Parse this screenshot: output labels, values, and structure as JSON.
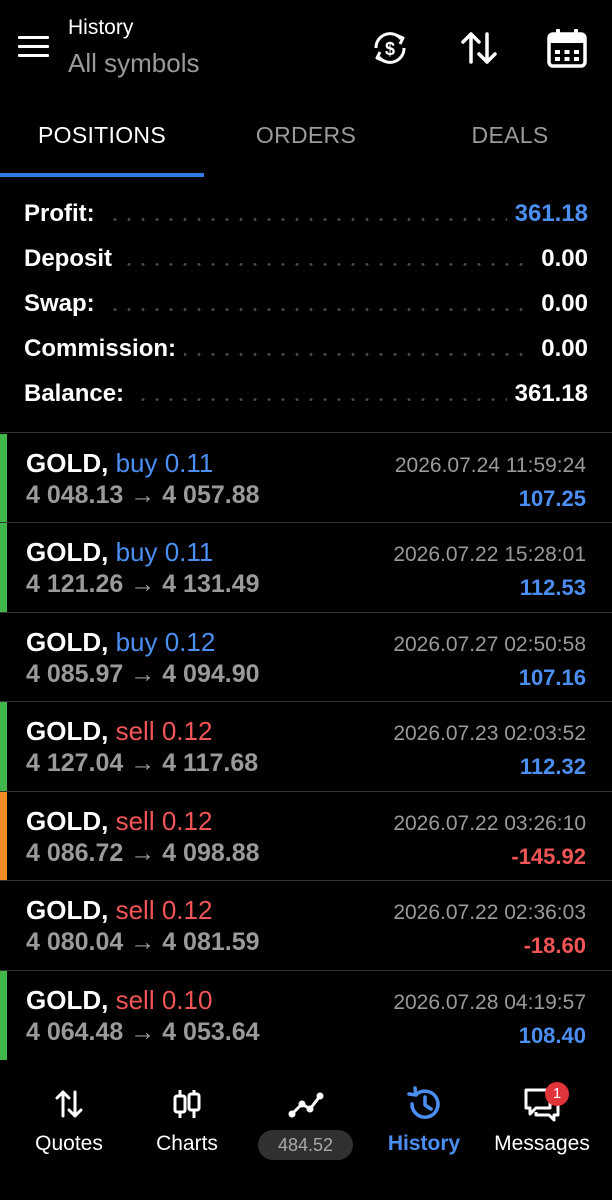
{
  "header": {
    "title": "History",
    "subtitle": "All symbols",
    "icons": [
      "menu-icon",
      "currency-exchange-icon",
      "sort-icon",
      "calendar-icon"
    ]
  },
  "tabs": [
    {
      "label": "POSITIONS",
      "active": true
    },
    {
      "label": "ORDERS",
      "active": false
    },
    {
      "label": "DEALS",
      "active": false
    }
  ],
  "summary": [
    {
      "label": "Profit:",
      "value": "361.18",
      "highlight": true
    },
    {
      "label": "Deposit",
      "value": "0.00",
      "highlight": false
    },
    {
      "label": "Swap:",
      "value": "0.00",
      "highlight": false
    },
    {
      "label": "Commission:",
      "value": "0.00",
      "highlight": false
    },
    {
      "label": "Balance:",
      "value": "361.18",
      "highlight": false
    }
  ],
  "trades": [
    {
      "symbol": "GOLD,",
      "side": "buy 0.11",
      "type": "buy",
      "prices": "4 048.13 → 4 057.88",
      "time": "2026.07.24 11:59:24",
      "profit": "107.25",
      "profit_sign": "pos",
      "marker": "#3fb54a"
    },
    {
      "symbol": "GOLD,",
      "side": "buy 0.11",
      "type": "buy",
      "prices": "4 121.26 → 4 131.49",
      "time": "2026.07.22 15:28:01",
      "profit": "112.53",
      "profit_sign": "pos",
      "marker": "#3fb54a"
    },
    {
      "symbol": "GOLD,",
      "side": "buy 0.12",
      "type": "buy",
      "prices": "4 085.97 → 4 094.90",
      "time": "2026.07.27 02:50:58",
      "profit": "107.16",
      "profit_sign": "pos",
      "marker": ""
    },
    {
      "symbol": "GOLD,",
      "side": "sell 0.12",
      "type": "sell",
      "prices": "4 127.04 → 4 117.68",
      "time": "2026.07.23 02:03:52",
      "profit": "112.32",
      "profit_sign": "pos",
      "marker": "#3fb54a"
    },
    {
      "symbol": "GOLD,",
      "side": "sell 0.12",
      "type": "sell",
      "prices": "4 086.72 → 4 098.88",
      "time": "2026.07.22 03:26:10",
      "profit": "-145.92",
      "profit_sign": "neg",
      "marker": "#f08a24"
    },
    {
      "symbol": "GOLD,",
      "side": "sell 0.12",
      "type": "sell",
      "prices": "4 080.04 → 4 081.59",
      "time": "2026.07.22 02:36:03",
      "profit": "-18.60",
      "profit_sign": "neg",
      "marker": ""
    },
    {
      "symbol": "GOLD,",
      "side": "sell 0.10",
      "type": "sell",
      "prices": "4 064.48 → 4 053.64",
      "time": "2026.07.28 04:19:57",
      "profit": "108.40",
      "profit_sign": "pos",
      "marker": "#3fb54a"
    }
  ],
  "nav": {
    "items": [
      {
        "label": "Quotes",
        "icon": "quotes-icon",
        "active": false
      },
      {
        "label": "Charts",
        "icon": "charts-icon",
        "active": false
      },
      {
        "label": "",
        "icon": "trade-icon",
        "active": false
      },
      {
        "label": "History",
        "icon": "history-icon",
        "active": true
      },
      {
        "label": "Messages",
        "icon": "messages-icon",
        "active": false
      }
    ],
    "balance_pill": "484.52",
    "messages_badge": "1"
  },
  "colors": {
    "accent": "#4b8ff2",
    "negative": "#f25555",
    "background": "#000000",
    "muted_text": "#9a9a9a"
  }
}
